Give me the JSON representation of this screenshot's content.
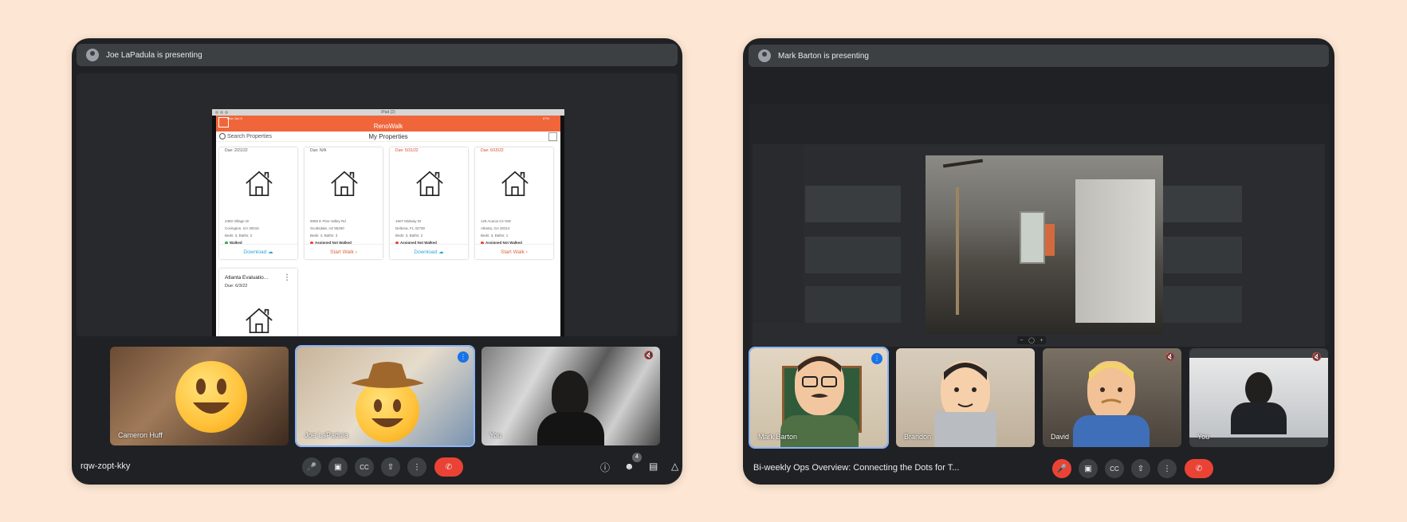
{
  "left_meeting": {
    "presenting_label": "Joe LaPadula is presenting",
    "meeting_code": "rqw-zopt-kky",
    "people_count": "4",
    "share": {
      "window_title": "iPad (2)",
      "status_time": "Mon Jun 6",
      "status_battery": "67%",
      "app_name": "RenoWalk",
      "search_placeholder": "Search Properties",
      "page_title": "My Properties",
      "cards": [
        {
          "due": "Due: 2/21/22",
          "addr1": "2360 Village Dr",
          "addr2": "Covington, GA 30016",
          "beds": "Beds: 3, Baths: 2",
          "status": "Walked",
          "action": "Download",
          "kind": "dl",
          "status_color": "#34a853",
          "due_red": false
        },
        {
          "due": "Due: N/A",
          "addr1": "9056 E Pine Valley Rd",
          "addr2": "Scottsdale, AZ 85260",
          "beds": "Beds: 4, Baths: 3",
          "status": "Assigned Not Walked",
          "action": "Start Walk",
          "kind": "sw",
          "status_color": "#ea4335",
          "due_red": false
        },
        {
          "due": "Due: 5/31/22",
          "addr1": "1607 Midway Dr",
          "addr2": "Deltona, FL 32738",
          "beds": "Beds: 3, Baths: 2",
          "status": "Assigned Not Walked",
          "action": "Download",
          "kind": "dl",
          "status_color": "#ea4335",
          "due_red": true
        },
        {
          "due": "Due: 6/15/22",
          "addr1": "125 Acacia Cir NW",
          "addr2": "Atlanta, GA 30314",
          "beds": "Beds: 3, Baths: 1",
          "status": "Assigned Not Walked",
          "action": "Start Walk",
          "kind": "sw",
          "status_color": "#ea4335",
          "due_red": true
        }
      ],
      "extra_card": {
        "title": "Atlanta Evaluatio...",
        "due": "Due: 6/3/22"
      }
    },
    "participants": [
      {
        "name": "Cameron Huff"
      },
      {
        "name": "Joe LaPadula"
      },
      {
        "name": "You"
      }
    ]
  },
  "right_meeting": {
    "presenting_label": "Mark Barton is presenting",
    "meeting_title": "Bi-weekly Ops Overview: Connecting the Dots for T...",
    "participants": [
      {
        "name": "Mark Barton"
      },
      {
        "name": "Brandon"
      },
      {
        "name": "David"
      },
      {
        "name": "You"
      }
    ]
  },
  "colors": {
    "accent": "#8ab4f8",
    "leave": "#ea4335",
    "app_orange": "#f0663a"
  }
}
